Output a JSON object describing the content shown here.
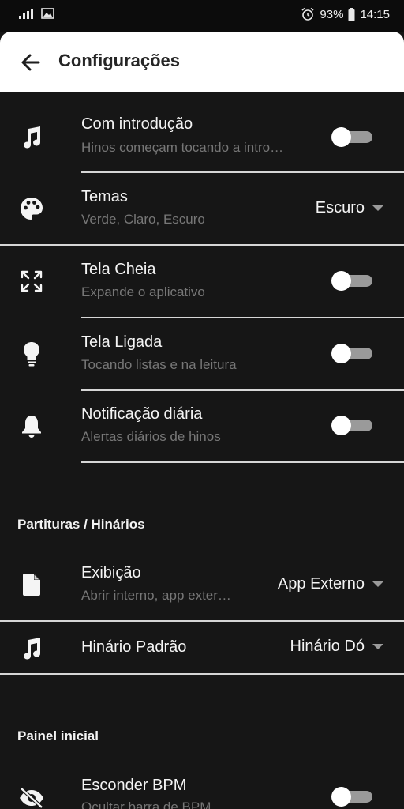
{
  "status_bar": {
    "icons": [
      "signal-icon",
      "image-icon",
      "alarm-icon",
      "battery-icon"
    ],
    "battery": "93%",
    "time": "14:15"
  },
  "appbar": {
    "title": "Configurações",
    "back_icon": "arrow-left-icon"
  },
  "settings": [
    {
      "icon": "music-note-icon",
      "title": "Com introdução",
      "subtitle": "Hinos começam tocando a intro…",
      "control": "toggle",
      "on": false
    },
    {
      "icon": "palette-icon",
      "title": "Temas",
      "subtitle": "Verde, Claro, Escuro",
      "control": "dropdown",
      "value": "Escuro"
    },
    {
      "icon": "fullscreen-icon",
      "title": "Tela Cheia",
      "subtitle": "Expande o aplicativo",
      "control": "toggle",
      "on": false
    },
    {
      "icon": "lightbulb-icon",
      "title": "Tela Ligada",
      "subtitle": "Tocando listas e na leitura",
      "control": "toggle",
      "on": false
    },
    {
      "icon": "bell-icon",
      "title": "Notificação diária",
      "subtitle": "Alertas diários de hinos",
      "control": "toggle",
      "on": false
    }
  ],
  "section_sheets": {
    "header": "Partituras / Hinários",
    "items": [
      {
        "icon": "file-icon",
        "title": "Exibição",
        "subtitle": "Abrir interno, app exter…",
        "control": "dropdown",
        "value": "App Externo"
      },
      {
        "icon": "music-note-icon",
        "title": "Hinário Padrão",
        "control": "dropdown",
        "value": "Hinário Dó"
      }
    ]
  },
  "section_home": {
    "header": "Painel inicial",
    "items": [
      {
        "icon": "eye-off-icon",
        "title": "Esconder BPM",
        "subtitle": "Ocultar barra de BPM",
        "control": "toggle",
        "on": false
      }
    ]
  }
}
